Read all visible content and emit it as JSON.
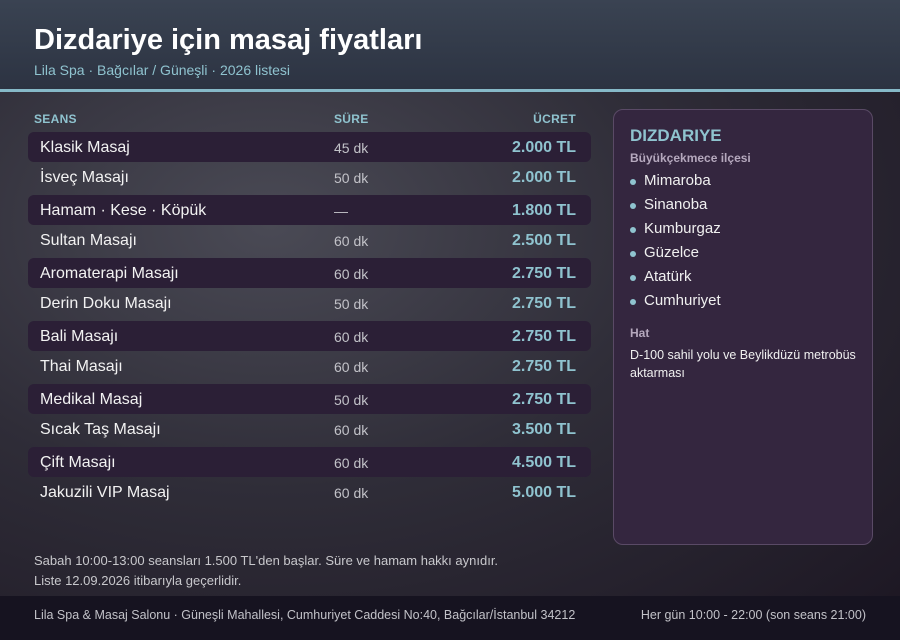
{
  "header": {
    "title": "Dizdariye için masaj fiyatları",
    "subtitle": "Lila Spa · Bağcılar / Güneşli · 2026 listesi"
  },
  "table": {
    "columns": [
      "SEANS",
      "SÜRE",
      "ÜCRET"
    ],
    "rows": [
      {
        "name": "Klasik Masaj",
        "duration": "45 dk",
        "price": "2.000 TL"
      },
      {
        "name": "İsveç Masajı",
        "duration": "50 dk",
        "price": "2.000 TL"
      },
      {
        "name": "Hamam · Kese · Köpük",
        "duration": "—",
        "price": "1.800 TL"
      },
      {
        "name": "Sultan Masajı",
        "duration": "60 dk",
        "price": "2.500 TL"
      },
      {
        "name": "Aromaterapi Masajı",
        "duration": "60 dk",
        "price": "2.750 TL"
      },
      {
        "name": "Derin Doku Masajı",
        "duration": "50 dk",
        "price": "2.750 TL"
      },
      {
        "name": "Bali Masajı",
        "duration": "60 dk",
        "price": "2.750 TL"
      },
      {
        "name": "Thai Masajı",
        "duration": "60 dk",
        "price": "2.750 TL"
      },
      {
        "name": "Medikal Masaj",
        "duration": "50 dk",
        "price": "2.750 TL"
      },
      {
        "name": "Sıcak Taş Masajı",
        "duration": "60 dk",
        "price": "3.500 TL"
      },
      {
        "name": "Çift Masajı",
        "duration": "60 dk",
        "price": "4.500 TL"
      },
      {
        "name": "Jakuzili VIP Masaj",
        "duration": "60 dk",
        "price": "5.000 TL"
      }
    ]
  },
  "notes": {
    "line1": "Sabah 10:00-13:00 seansları 1.500 TL'den başlar. Süre ve hamam hakkı aynıdır.",
    "line2": "Liste 12.09.2026 itibarıyla geçerlidir."
  },
  "panel": {
    "title": "DIZDARIYE",
    "subtitle": "Büyükçekmece ilçesi",
    "districts": [
      "Mimaroba",
      "Sinanoba",
      "Kumburgaz",
      "Güzelce",
      "Atatürk",
      "Cumhuriyet"
    ],
    "hat_label": "Hat",
    "hat_text": "D-100 sahil yolu ve Beylikdüzü metrobüs aktarması"
  },
  "footer": {
    "address": "Lila Spa & Masaj Salonu · Güneşli Mahallesi, Cumhuriyet Caddesi No:40, Bağcılar/İstanbul 34212",
    "hours": "Her gün 10:00 - 22:00 (son seans 21:00)"
  },
  "colors": {
    "accent": "#8fc3cf",
    "row_shade": "#2b1f36",
    "panel_bg": "#34263f"
  }
}
